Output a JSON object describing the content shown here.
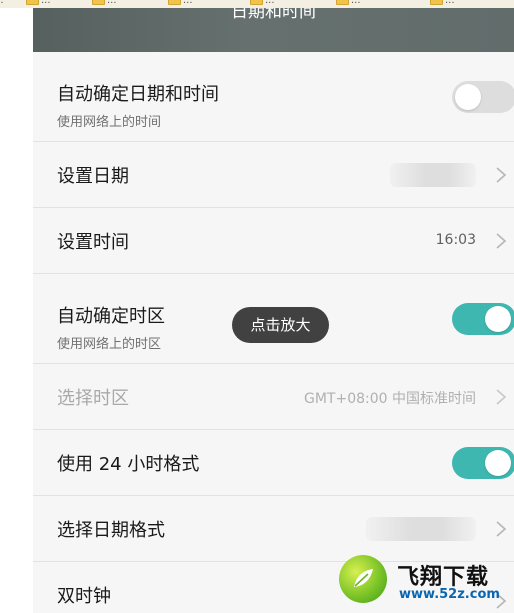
{
  "bookmarks": [
    "...",
    "...",
    "...",
    "...",
    "...",
    "...",
    "..."
  ],
  "screen": {
    "title": "日期和时间"
  },
  "settings": [
    {
      "label": "自动确定日期和时间",
      "sublabel": "使用网络上的时间",
      "control": "toggle",
      "state": "off"
    },
    {
      "label": "设置日期",
      "control": "chevron",
      "value_blurred": true
    },
    {
      "label": "设置时间",
      "control": "chevron",
      "value": "16:03"
    },
    {
      "label": "自动确定时区",
      "sublabel": "使用网络上的时区",
      "control": "toggle",
      "state": "on"
    },
    {
      "label": "选择时区",
      "control": "chevron",
      "value": "GMT+08:00 中国标准时间",
      "disabled": true
    },
    {
      "label": "使用 24 小时格式",
      "control": "toggle",
      "state": "on"
    },
    {
      "label": "选择日期格式",
      "control": "chevron",
      "value_blurred": true
    },
    {
      "label": "双时钟",
      "control": "chevron"
    }
  ],
  "overlay": {
    "zoom_hint": "点击放大"
  },
  "watermark": {
    "name": "飞翔下载",
    "url": "www.52z.com"
  },
  "colors": {
    "accent": "#3eb7b1",
    "titlebar": "#5f6a69",
    "background": "#f6f6f6",
    "toggle_off": "#dddddd"
  },
  "icons": [
    "chevron-right-icon",
    "folder-icon",
    "leaf-logo-icon"
  ]
}
